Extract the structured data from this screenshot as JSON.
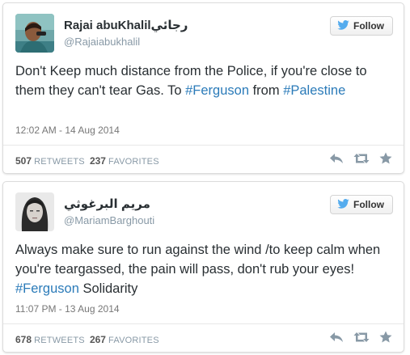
{
  "tweets": [
    {
      "name_latin": "Rajai abuKhalil",
      "name_arabic": "رجائي",
      "handle": "@Rajaiabukhalil",
      "follow_label": "Follow",
      "text_before": "Don't Keep much distance from the Police, if you're close to them they can't tear Gas. To ",
      "hashtag1": "#Ferguson",
      "text_middle": " from ",
      "hashtag2": "#Palestine",
      "text_after": "",
      "timestamp": "12:02 AM - 14 Aug 2014",
      "retweets": "507",
      "retweets_label": "RETWEETS",
      "favorites": "237",
      "favorites_label": "FAVORITES"
    },
    {
      "name_latin": "",
      "name_arabic": "مريم البرغوثي",
      "handle": "@MariamBarghouti",
      "follow_label": "Follow",
      "text_before": "Always make sure to run against the wind /to keep calm when you're teargassed, the pain will pass, don't rub your eyes! ",
      "hashtag1": "#Ferguson",
      "text_middle": " Solidarity",
      "hashtag2": "",
      "text_after": "",
      "timestamp": "11:07 PM - 13 Aug 2014",
      "retweets": "678",
      "retweets_label": "RETWEETS",
      "favorites": "267",
      "favorites_label": "FAVORITES"
    }
  ],
  "colors": {
    "link": "#2b7bb9",
    "twitter_blue": "#55acee",
    "text": "#292f33",
    "muted": "#8899a6"
  },
  "icons": [
    "twitter-bird-icon",
    "reply-icon",
    "retweet-icon",
    "favorite-star-icon"
  ]
}
